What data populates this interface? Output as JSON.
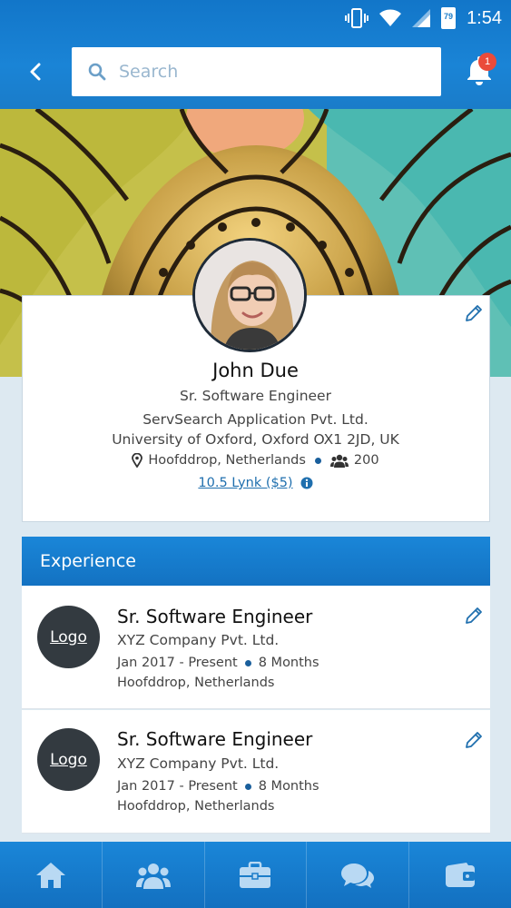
{
  "status_bar": {
    "time": "1:54",
    "battery": "79"
  },
  "search": {
    "placeholder": "Search"
  },
  "notifications": {
    "count": "1"
  },
  "profile": {
    "name": "John Due",
    "title": "Sr. Software Engineer",
    "company": "ServSearch Application Pvt. Ltd.",
    "education": "University of Oxford, Oxford OX1 2JD, UK",
    "location": "Hoofddrop, Netherlands",
    "connections": "200",
    "lynk": "10.5 Lynk ($5)"
  },
  "experience": {
    "header": "Experience",
    "items": [
      {
        "logo": "Logo",
        "title": "Sr. Software Engineer",
        "company": "XYZ Company Pvt. Ltd.",
        "dates": "Jan 2017 - Present",
        "duration": "8 Months",
        "location": "Hoofddrop, Netherlands"
      },
      {
        "logo": "Logo",
        "title": "Sr. Software Engineer",
        "company": "XYZ Company Pvt. Ltd.",
        "dates": "Jan 2017 - Present",
        "duration": "8 Months",
        "location": "Hoofddrop, Netherlands"
      }
    ]
  },
  "bottom_nav": {
    "items": [
      "home-icon",
      "people-icon",
      "briefcase-icon",
      "chat-icon",
      "wallet-icon"
    ]
  },
  "colors": {
    "primary": "#1a7cc9",
    "badge": "#ea4b3a",
    "accent_dot": "#1a5f9c"
  }
}
